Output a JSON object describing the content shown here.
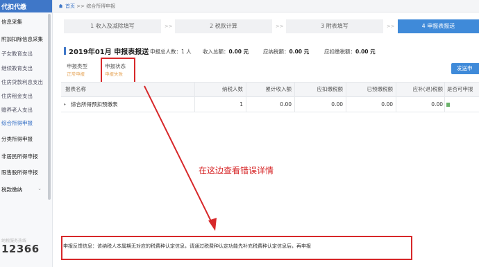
{
  "sidebar": {
    "header": "代扣代缴",
    "items": [
      {
        "label": "信息采集",
        "active": false
      },
      {
        "label": "附加扣除信息采集",
        "chevron": "chevron-down-icon"
      },
      {
        "label": "子女教育支出"
      },
      {
        "label": "继续教育支出"
      },
      {
        "label": "住房贷款利息支出"
      },
      {
        "label": "住房租金支出"
      },
      {
        "label": "赡养老人支出"
      },
      {
        "label": "综合所得申报"
      },
      {
        "label": "分类所得申报"
      },
      {
        "label": "非居民所得申报"
      },
      {
        "label": "限售股所得申报"
      },
      {
        "label": "税款缴纳",
        "chevron": "chevron-down-icon"
      }
    ],
    "hotline_label": "纳税服务热线",
    "hotline": "12366"
  },
  "breadcrumb": {
    "home": "首页",
    "separator": ">>",
    "current": "综合所得申报"
  },
  "steps": [
    {
      "label": "1 收入及减除填写",
      "active": false
    },
    {
      "label": "2 税款计算",
      "active": false
    },
    {
      "label": "3 附表填写",
      "active": false
    },
    {
      "label": "4 申报表报送",
      "active": true
    }
  ],
  "step_separator": ">>",
  "summary": {
    "title": "2019年01月  申报表报送",
    "total_people_label": "申报总人数：",
    "total_people_value": "1 人",
    "income_label": "收入总额：",
    "income_value": "0.00 元",
    "tax_payable_label": "应纳税额：",
    "tax_payable_value": "0.00 元",
    "tax_withheld_label": "应扣缴税额：",
    "tax_withheld_value": "0.00 元"
  },
  "filters": {
    "type_label": "申报类型",
    "type_value": "正常申报",
    "status_label": "申报状态",
    "status_value": "申报失败"
  },
  "send_button": "发送申",
  "table": {
    "columns": [
      "报表名称",
      "纳税人数",
      "累计收入额",
      "应扣缴税额",
      "已预缴税额",
      "应补(退)税额",
      "是否可申报"
    ],
    "rows": [
      {
        "name": "综合所得预扣预缴表",
        "people": "1",
        "income": "0.00",
        "withhold": "0.00",
        "prepaid": "0.00",
        "refund": "0.00"
      }
    ]
  },
  "annotation": "在这边查看错误详情",
  "feedback": "申报反馈信息：该纳税人本属期无对应的税费种认定信息，请通过税费种认定功能先补充税费种认定信息后，再申报",
  "colors": {
    "accent": "#3f8ad9",
    "highlight_red": "#d7282a",
    "status_orange": "#e6a75c"
  }
}
